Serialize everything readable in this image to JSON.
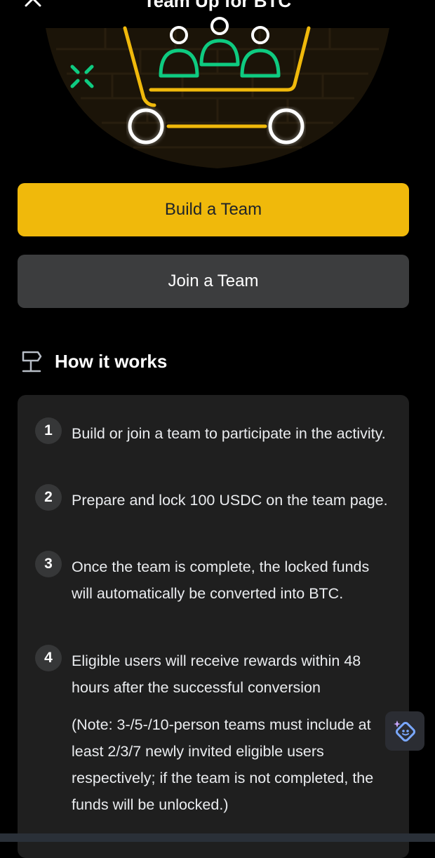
{
  "header": {
    "title": "Team Up for BTC",
    "close_icon": "close-icon"
  },
  "hero": {
    "illustration": "team-cart-illustration",
    "colors": {
      "green": "#0ecb81",
      "yellow": "#f0b90b",
      "white": "#ffffff"
    }
  },
  "actions": {
    "build_label": "Build a Team",
    "join_label": "Join a Team"
  },
  "how_it_works": {
    "title": "How it works",
    "icon": "signpost-icon",
    "steps": [
      {
        "num": "1",
        "text": "Build or join a team to participate in the activity."
      },
      {
        "num": "2",
        "text": "Prepare and lock 100 USDC on the team page."
      },
      {
        "num": "3",
        "text": "Once the team is complete, the locked funds will automatically be converted into BTC."
      },
      {
        "num": "4",
        "text": "Eligible users will receive rewards within 48 hours after the successful conversion"
      }
    ],
    "note": "(Note: 3-/5-/10-person teams must include at least 2/3/7 newly invited eligible users respectively; if the team is not completed, the funds will be unlocked.)"
  },
  "floating_assistant": {
    "icon": "assistant-sparkle-icon"
  },
  "colors": {
    "accent": "#f0b90b",
    "background": "#000000",
    "card": "#1f1f1f"
  }
}
